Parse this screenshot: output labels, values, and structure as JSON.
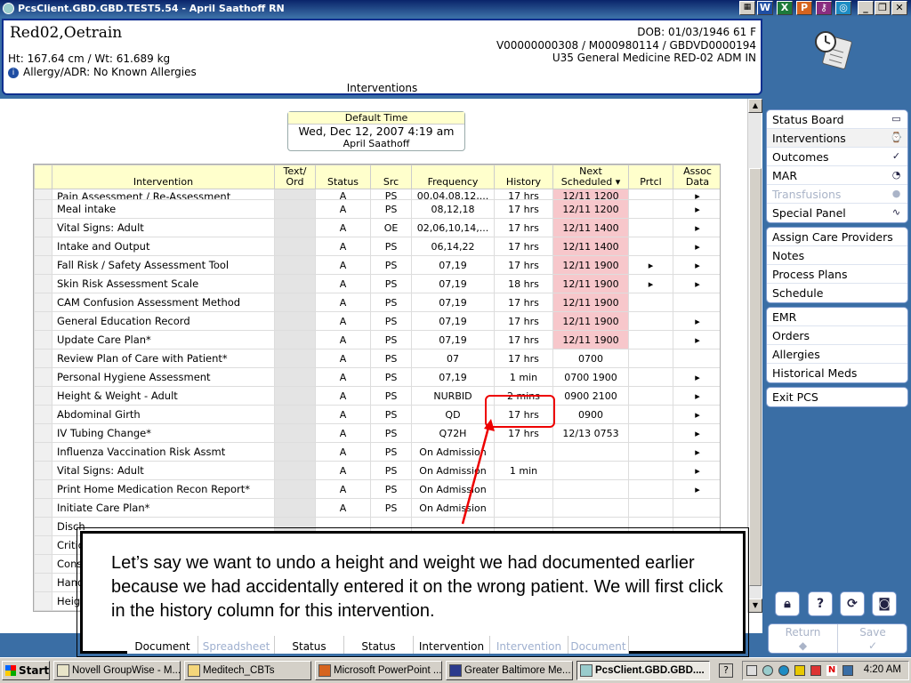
{
  "window": {
    "title": "PcsClient.GBD.GBD.TEST5.54 - April Saathoff RN"
  },
  "patient": {
    "name": "Red02,Oetrain",
    "height_weight": "Ht: 167.64 cm / Wt: 61.689 kg",
    "allergy": "Allergy/ADR: No Known Allergies",
    "dob": "DOB: 01/03/1946 61 F",
    "account": "V00000000308 / M000980114 / GBDVD0000194",
    "location": "U35 General Medicine  RED-02  ADM IN",
    "screen_title": "Interventions"
  },
  "default_time": {
    "label": "Default Time",
    "value": "Wed, Dec 12, 2007  4:19 am",
    "user": "April Saathoff"
  },
  "table": {
    "headers": {
      "intervention": "Intervention",
      "text_ord": "Text/ Ord",
      "status": "Status",
      "src": "Src",
      "frequency": "Frequency",
      "history": "History",
      "next": "Next Scheduled",
      "prtcl": "Prtcl",
      "assoc": "Assoc Data"
    },
    "rows": [
      {
        "name": "Pain Assessment / Re-Assessment",
        "status": "A",
        "src": "PS",
        "freq": "00,04,08,12,...",
        "hist": "17 hrs",
        "next": "12/11 1200",
        "pink": true,
        "prtcl": "",
        "assoc": "▸"
      },
      {
        "name": "Meal intake",
        "status": "A",
        "src": "PS",
        "freq": "08,12,18",
        "hist": "17 hrs",
        "next": "12/11 1200",
        "pink": true,
        "prtcl": "",
        "assoc": "▸"
      },
      {
        "name": "Vital Signs: Adult",
        "status": "A",
        "src": "OE",
        "freq": "02,06,10,14,...",
        "hist": "17 hrs",
        "next": "12/11 1400",
        "pink": true,
        "prtcl": "",
        "assoc": "▸"
      },
      {
        "name": "Intake and Output",
        "status": "A",
        "src": "PS",
        "freq": "06,14,22",
        "hist": "17 hrs",
        "next": "12/11 1400",
        "pink": true,
        "prtcl": "",
        "assoc": "▸"
      },
      {
        "name": "Fall Risk / Safety Assessment Tool",
        "status": "A",
        "src": "PS",
        "freq": "07,19",
        "hist": "17 hrs",
        "next": "12/11 1900",
        "pink": true,
        "prtcl": "▸",
        "assoc": "▸"
      },
      {
        "name": "Skin Risk Assessment Scale",
        "status": "A",
        "src": "PS",
        "freq": "07,19",
        "hist": "18 hrs",
        "next": "12/11 1900",
        "pink": true,
        "prtcl": "▸",
        "assoc": "▸"
      },
      {
        "name": "CAM Confusion Assessment Method",
        "status": "A",
        "src": "PS",
        "freq": "07,19",
        "hist": "17 hrs",
        "next": "12/11 1900",
        "pink": true,
        "prtcl": "",
        "assoc": ""
      },
      {
        "name": "General Education Record",
        "status": "A",
        "src": "PS",
        "freq": "07,19",
        "hist": "17 hrs",
        "next": "12/11 1900",
        "pink": true,
        "prtcl": "",
        "assoc": "▸"
      },
      {
        "name": "Update Care Plan*",
        "status": "A",
        "src": "PS",
        "freq": "07,19",
        "hist": "17 hrs",
        "next": "12/11 1900",
        "pink": true,
        "prtcl": "",
        "assoc": "▸"
      },
      {
        "name": "Review Plan of Care with Patient*",
        "status": "A",
        "src": "PS",
        "freq": "07",
        "hist": "17 hrs",
        "next": "0700",
        "pink": false,
        "prtcl": "",
        "assoc": ""
      },
      {
        "name": "Personal Hygiene Assessment",
        "status": "A",
        "src": "PS",
        "freq": "07,19",
        "hist": "1 min",
        "next": "0700 1900",
        "pink": false,
        "prtcl": "",
        "assoc": "▸"
      },
      {
        "name": "Height & Weight - Adult",
        "status": "A",
        "src": "PS",
        "freq": "NURBID",
        "hist": "2 mins",
        "next": "0900 2100",
        "pink": false,
        "prtcl": "",
        "assoc": "▸"
      },
      {
        "name": "Abdominal Girth",
        "status": "A",
        "src": "PS",
        "freq": "QD",
        "hist": "17 hrs",
        "next": "0900",
        "pink": false,
        "prtcl": "",
        "assoc": "▸"
      },
      {
        "name": "IV Tubing Change*",
        "status": "A",
        "src": "PS",
        "freq": "Q72H",
        "hist": "17 hrs",
        "next": "12/13 0753",
        "pink": false,
        "prtcl": "",
        "assoc": "▸"
      },
      {
        "name": "Influenza Vaccination Risk Assmt",
        "status": "A",
        "src": "PS",
        "freq": "On Admission",
        "hist": "",
        "next": "",
        "pink": false,
        "prtcl": "",
        "assoc": "▸"
      },
      {
        "name": "Vital Signs: Adult",
        "status": "A",
        "src": "PS",
        "freq": "On Admission",
        "hist": "1 min",
        "next": "",
        "pink": false,
        "prtcl": "",
        "assoc": "▸"
      },
      {
        "name": "Print Home Medication Recon Report*",
        "status": "A",
        "src": "PS",
        "freq": "On Admission",
        "hist": "",
        "next": "",
        "pink": false,
        "prtcl": "",
        "assoc": "▸"
      },
      {
        "name": "Initiate Care Plan*",
        "status": "A",
        "src": "PS",
        "freq": "On Admission",
        "hist": "",
        "next": "",
        "pink": false,
        "prtcl": "",
        "assoc": ""
      },
      {
        "name": "Disch",
        "status": "",
        "src": "",
        "freq": "",
        "hist": "",
        "next": "",
        "pink": false,
        "prtcl": "",
        "assoc": ""
      },
      {
        "name": "Critic",
        "status": "",
        "src": "",
        "freq": "",
        "hist": "",
        "next": "",
        "pink": false,
        "prtcl": "",
        "assoc": ""
      },
      {
        "name": "Cons",
        "status": "",
        "src": "",
        "freq": "",
        "hist": "",
        "next": "",
        "pink": false,
        "prtcl": "",
        "assoc": ""
      },
      {
        "name": "Hand",
        "status": "",
        "src": "",
        "freq": "",
        "hist": "",
        "next": "",
        "pink": false,
        "prtcl": "",
        "assoc": ""
      },
      {
        "name": "Heigh",
        "status": "",
        "src": "",
        "freq": "",
        "hist": "",
        "next": "",
        "pink": false,
        "prtcl": "",
        "assoc": ""
      }
    ]
  },
  "sidebar": {
    "groups": [
      [
        {
          "label": "Status Board",
          "icon": "book-icon",
          "glyph": "▭",
          "disabled": false
        },
        {
          "label": "Interventions",
          "icon": "clipboard-clock-icon",
          "glyph": "⌚",
          "disabled": false,
          "active": true
        },
        {
          "label": "Outcomes",
          "icon": "checklist-icon",
          "glyph": "✓",
          "disabled": false
        },
        {
          "label": "MAR",
          "icon": "pill-icon",
          "glyph": "◔",
          "disabled": false
        },
        {
          "label": "Transfusions",
          "icon": "blood-drop-icon",
          "glyph": "●",
          "disabled": true
        },
        {
          "label": "Special Panel",
          "icon": "pulse-icon",
          "glyph": "∿",
          "disabled": false
        }
      ],
      [
        {
          "label": "Assign Care Providers"
        },
        {
          "label": "Notes"
        },
        {
          "label": "Process Plans"
        },
        {
          "label": "Schedule"
        }
      ],
      [
        {
          "label": "EMR"
        },
        {
          "label": "Orders"
        },
        {
          "label": "Allergies"
        },
        {
          "label": "Historical Meds"
        }
      ],
      [
        {
          "label": "Exit PCS"
        }
      ]
    ]
  },
  "callout": {
    "text": "Let’s say we want to undo a height and weight we had documented earlier because we had accidentally entered it on the wrong patient.  We will first click in the history column for this intervention."
  },
  "bottom_tabs": [
    "Document",
    "Spreadsheet",
    "Status",
    "Status",
    "Intervention",
    "Intervention",
    "Document"
  ],
  "action_buttons": {
    "return": "Return",
    "save": "Save"
  },
  "taskbar": {
    "start": "Start",
    "tasks": [
      "Novell GroupWise - M...",
      "Meditech_CBTs",
      "Microsoft PowerPoint ...",
      "Greater Baltimore Me...",
      "PcsClient.GBD.GBD...."
    ],
    "clock": "4:20 AM"
  },
  "colors": {
    "accent": "#0f2f8f",
    "overdue": "#f7c7cb",
    "header": "#ffffcc",
    "highlight": "#e00000"
  }
}
